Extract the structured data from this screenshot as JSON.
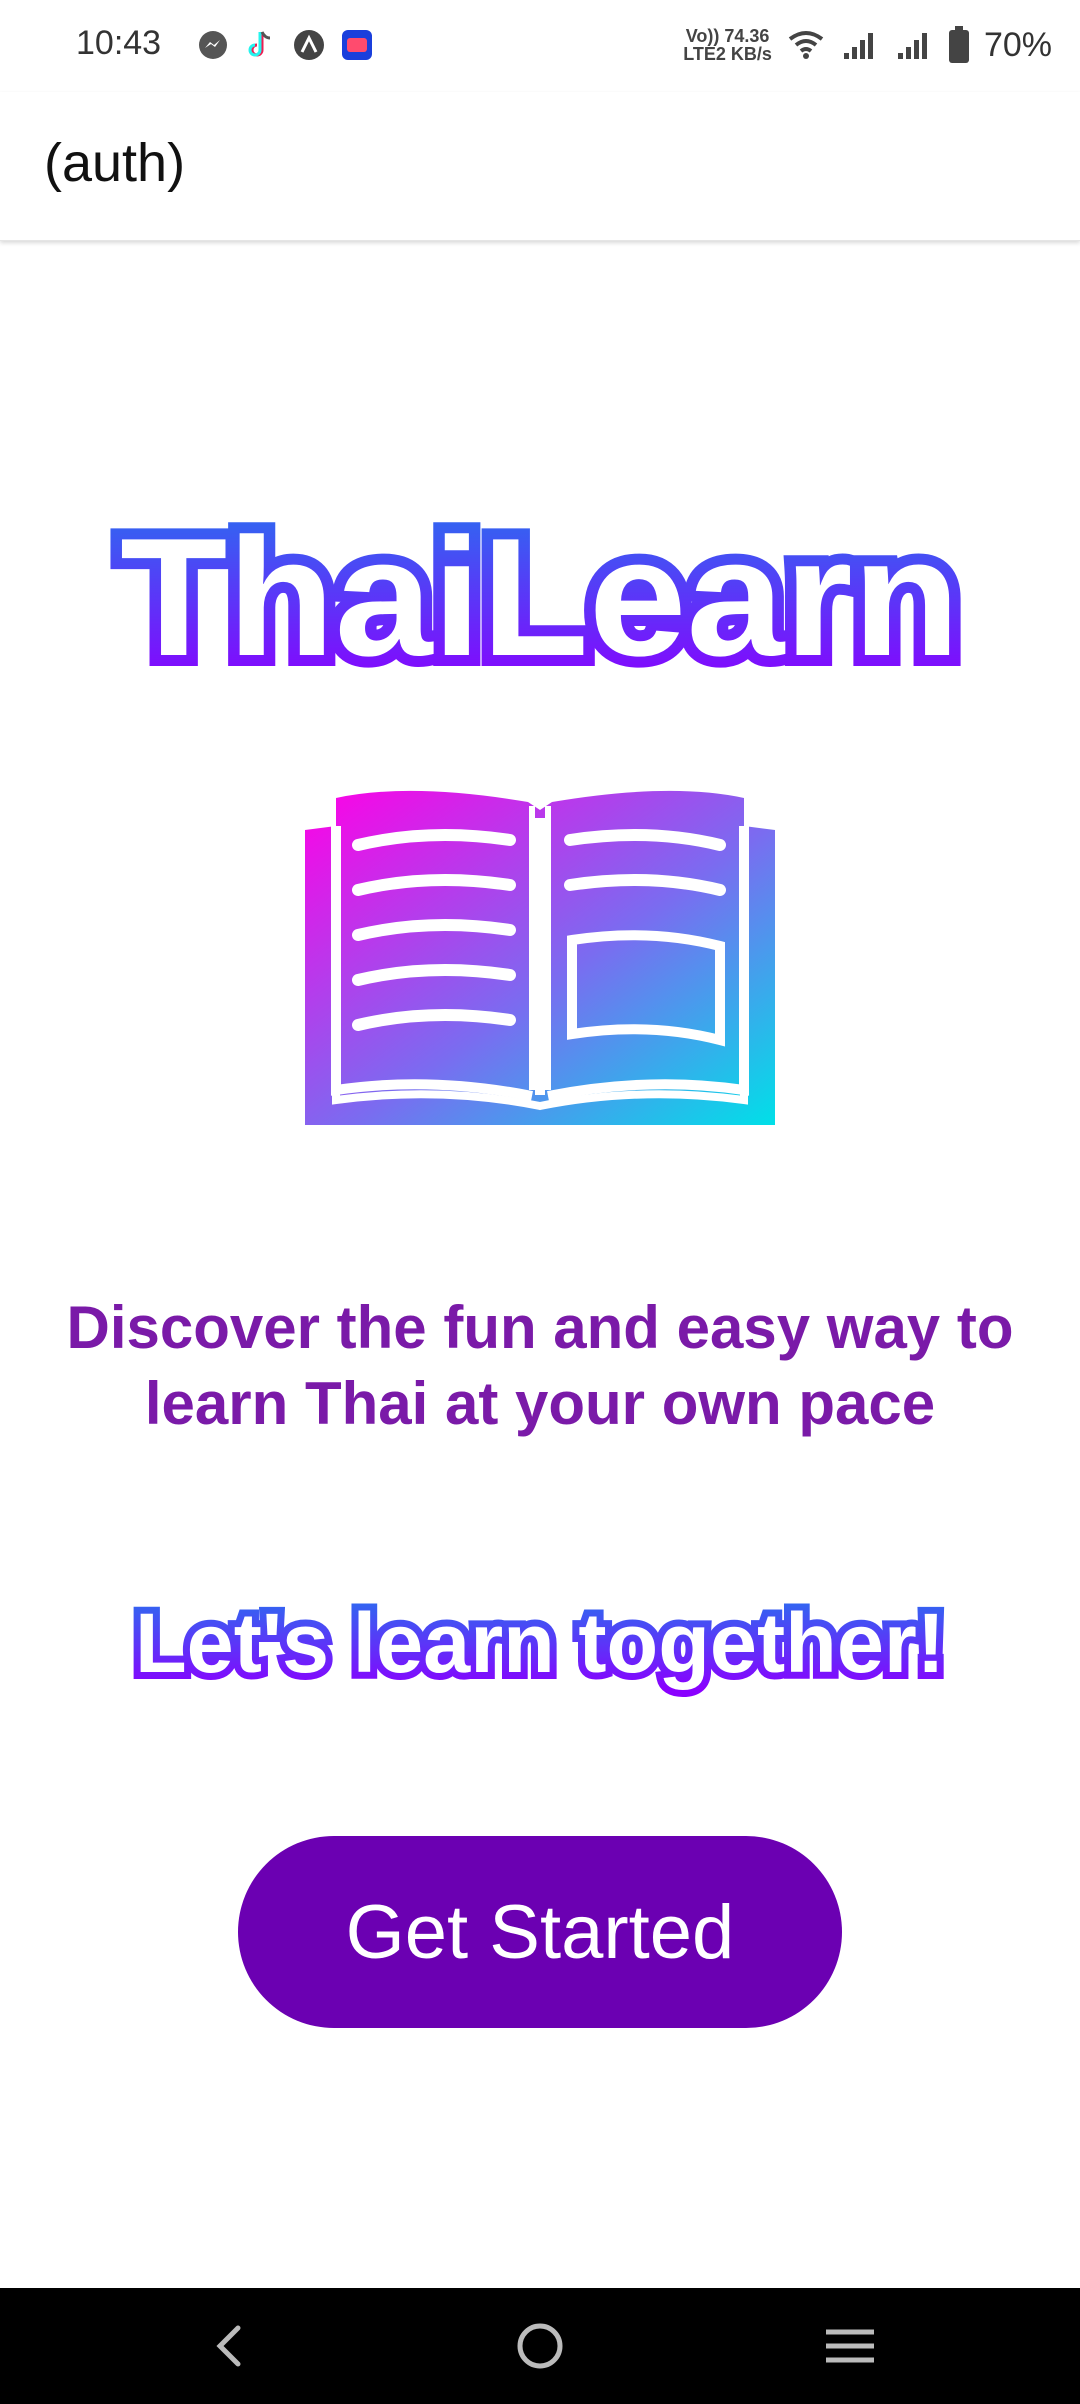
{
  "status_bar": {
    "time": "10:43",
    "network_line1": "Vo)) 74.36",
    "network_line2": "LTE2 KB/s",
    "battery": "70%",
    "app_icons": [
      "messenger-icon",
      "tiktok-icon",
      "expo-icon",
      "lazada-icon"
    ]
  },
  "app_bar": {
    "title": "(auth)"
  },
  "hero": {
    "logo_text": "ThaiLearn",
    "tagline": "Discover the fun and easy way to learn Thai at your own pace",
    "together_text": "Let's learn together!"
  },
  "cta": {
    "label": "Get Started"
  },
  "colors": {
    "primary": "#6b00b2",
    "tagline": "#7a1aa8",
    "logo_gradient_start": "#ff00e6",
    "logo_gradient_end": "#00e0e8"
  }
}
